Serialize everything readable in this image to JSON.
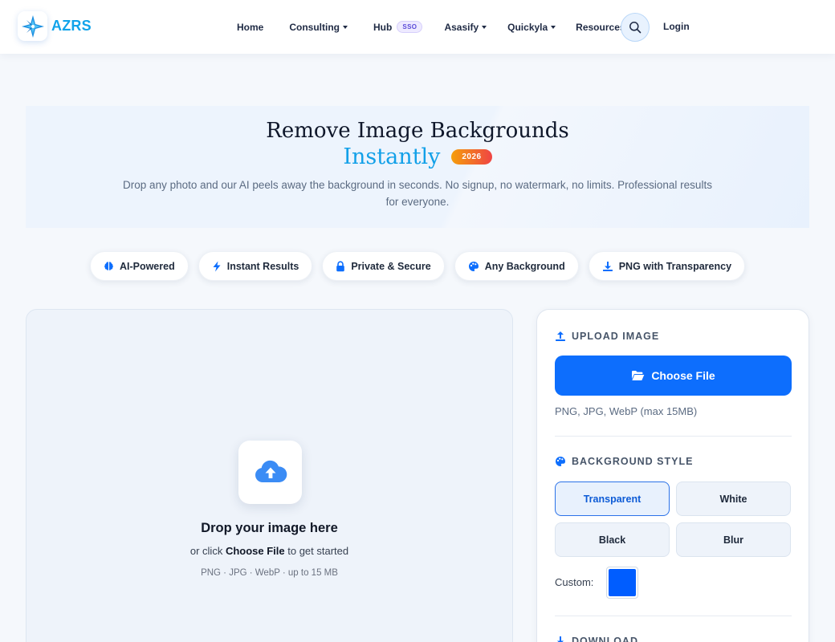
{
  "nav": {
    "brand": "AZRS",
    "items": [
      {
        "label": "Home",
        "caret": false
      },
      {
        "label": "Consulting",
        "caret": true
      },
      {
        "label": "Hub",
        "caret": false,
        "badge": "SSO"
      },
      {
        "label": "Asasify",
        "caret": true
      },
      {
        "label": "Quickyla",
        "caret": true
      },
      {
        "label": "Resources",
        "caret": true
      }
    ],
    "login": "Login"
  },
  "hero": {
    "title": "Remove Image Backgrounds",
    "accent": "Instantly",
    "badge": "2026",
    "description": "Drop any photo and our AI peels away the background in seconds. No signup, no watermark, no limits. Professional results for everyone."
  },
  "features": [
    {
      "label": "AI-Powered",
      "icon": "brain-icon"
    },
    {
      "label": "Instant Results",
      "icon": "bolt-icon"
    },
    {
      "label": "Private & Secure",
      "icon": "lock-icon"
    },
    {
      "label": "Any Background",
      "icon": "palette-icon"
    },
    {
      "label": "PNG with Transparency",
      "icon": "download-icon"
    }
  ],
  "dropzone": {
    "title": "Drop your image here",
    "sub_prefix": "or click ",
    "sub_strong": "Choose File",
    "sub_suffix": " to get started",
    "note": "PNG · JPG · WebP · up to 15 MB"
  },
  "panel": {
    "upload_heading": "UPLOAD IMAGE",
    "choose_file": "Choose File",
    "formats": "PNG, JPG, WebP (max 15MB)",
    "bg_heading": "BACKGROUND STYLE",
    "bg_options": [
      "Transparent",
      "White",
      "Black",
      "Blur"
    ],
    "bg_selected": "Transparent",
    "custom_label": "Custom:",
    "custom_color": "#005dff",
    "download_heading": "DOWNLOAD"
  },
  "colors": {
    "primary": "#0d6efd",
    "brand": "#11a3ea",
    "badge_start": "#f59e0b",
    "badge_end": "#ef4444"
  }
}
